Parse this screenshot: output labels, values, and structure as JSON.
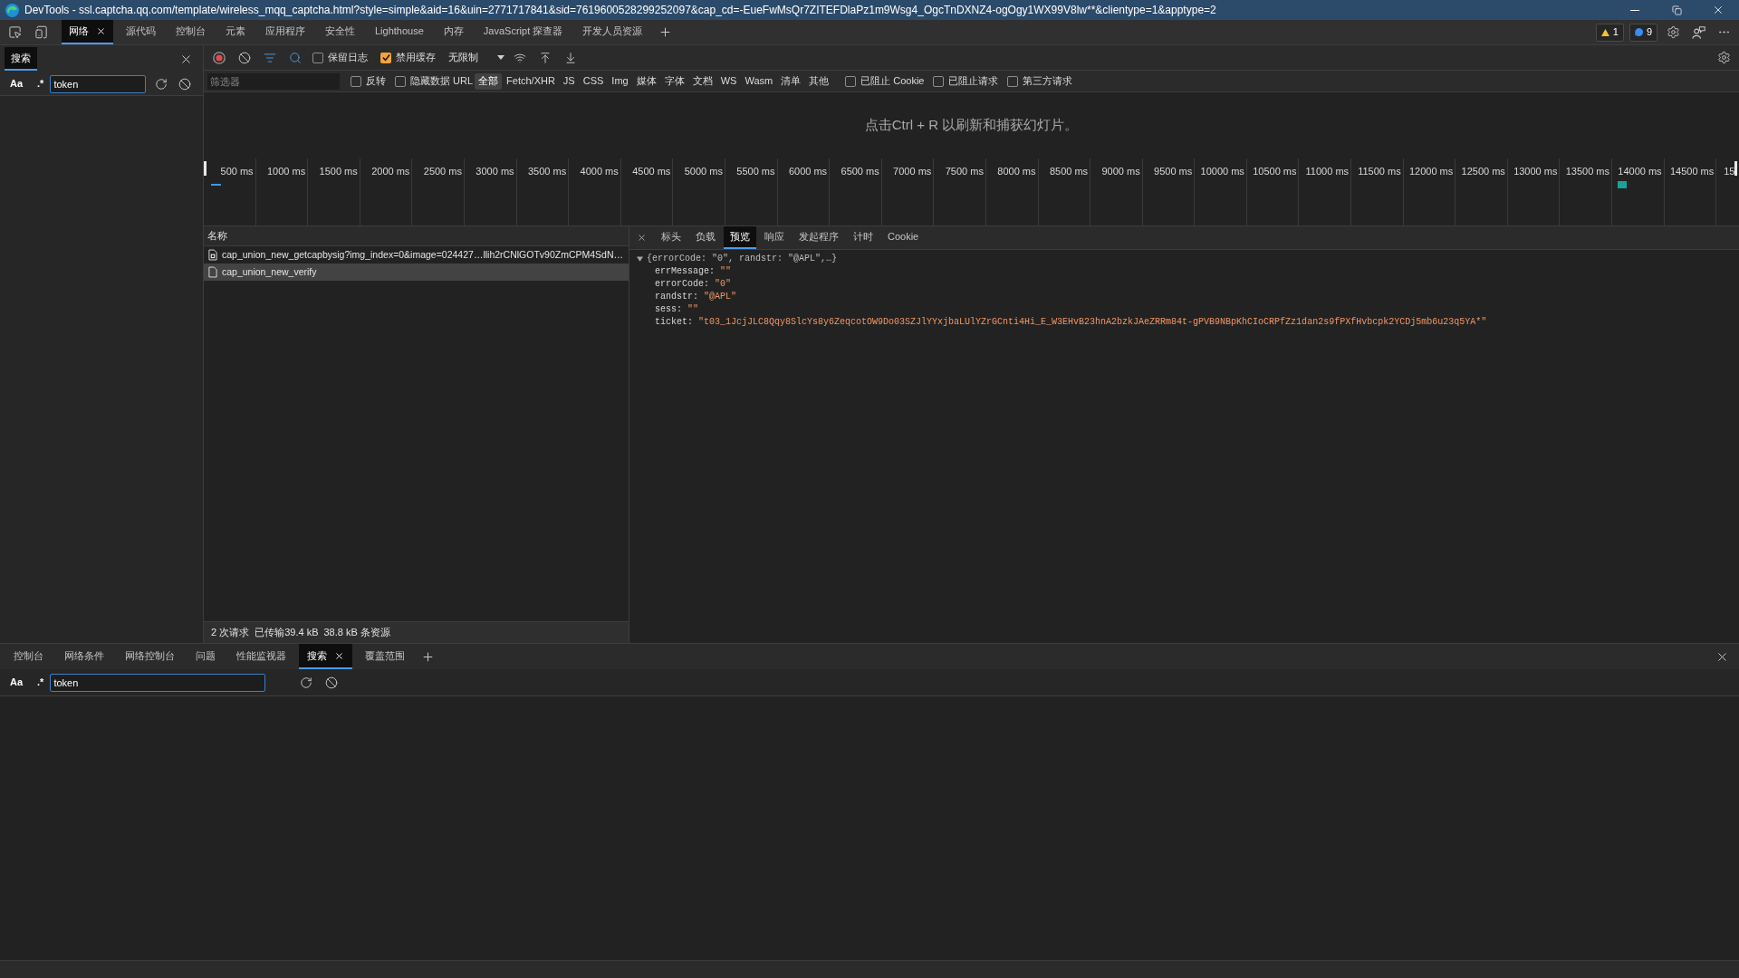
{
  "window": {
    "title": "DevTools - ssl.captcha.qq.com/template/wireless_mqq_captcha.html?style=simple&aid=16&uin=2771717841&sid=7619600528299252097&cap_cd=-EueFwMsQr7ZITEFDlaPz1m9Wsg4_OgcTnDXNZ4-ogOgy1WX99V8lw**&clientype=1&apptype=2"
  },
  "main_tabs": [
    {
      "label": "网络",
      "selected": true
    },
    {
      "label": "源代码",
      "selected": false
    },
    {
      "label": "控制台",
      "selected": false
    },
    {
      "label": "元素",
      "selected": false
    },
    {
      "label": "应用程序",
      "selected": false
    },
    {
      "label": "安全性",
      "selected": false
    },
    {
      "label": "Lighthouse",
      "selected": false
    },
    {
      "label": "内存",
      "selected": false
    },
    {
      "label": "JavaScript 探查器",
      "selected": false
    },
    {
      "label": "开发人员资源",
      "selected": false
    }
  ],
  "issue_badges": [
    {
      "kind": "warning",
      "count": "1"
    },
    {
      "kind": "info",
      "count": "9"
    }
  ],
  "search_sidebar": {
    "tab": {
      "label": "搜索",
      "selected": true
    },
    "match_case": "Aa",
    "regex": ".*",
    "query": "token"
  },
  "network_toolbar": {
    "recording": true,
    "preserve_log": {
      "label": "保留日志",
      "checked": false
    },
    "disable_cache": {
      "label": "禁用缓存",
      "checked": true
    },
    "throttling": "无限制"
  },
  "filter_bar": {
    "placeholder": "筛选器",
    "invert": {
      "label": "反转",
      "checked": false
    },
    "hide_data_urls": {
      "label": "隐藏数据 URL",
      "checked": false
    },
    "types": [
      {
        "label": "全部",
        "selected": true
      },
      {
        "label": "Fetch/XHR",
        "selected": false
      },
      {
        "label": "JS",
        "selected": false
      },
      {
        "label": "CSS",
        "selected": false
      },
      {
        "label": "Img",
        "selected": false
      },
      {
        "label": "媒体",
        "selected": false
      },
      {
        "label": "字体",
        "selected": false
      },
      {
        "label": "文档",
        "selected": false
      },
      {
        "label": "WS",
        "selected": false
      },
      {
        "label": "Wasm",
        "selected": false
      },
      {
        "label": "清单",
        "selected": false
      },
      {
        "label": "其他",
        "selected": false
      }
    ],
    "blocked_cookies": {
      "label": "已阻止 Cookie",
      "checked": false
    },
    "blocked_requests": {
      "label": "已阻止请求",
      "checked": false
    },
    "third_party": {
      "label": "第三方请求",
      "checked": false
    }
  },
  "overview": {
    "message": "点击Ctrl + R 以刷新和捕获幻灯片。",
    "ticks": [
      "500 ms",
      "1000 ms",
      "1500 ms",
      "2000 ms",
      "2500 ms",
      "3000 ms",
      "3500 ms",
      "4000 ms",
      "4500 ms",
      "5000 ms",
      "5500 ms",
      "6000 ms",
      "6500 ms",
      "7000 ms",
      "7500 ms",
      "8000 ms",
      "8500 ms",
      "9000 ms",
      "9500 ms",
      "10000 ms",
      "10500 ms",
      "11000 ms",
      "11500 ms",
      "12000 ms",
      "12500 ms",
      "13000 ms",
      "13500 ms",
      "14000 ms",
      "14500 ms",
      "15"
    ]
  },
  "request_table": {
    "column": "名称",
    "rows": [
      {
        "name": "cap_union_new_getcapbysig?img_index=0&image=024427…llih2rCNlGOTv90ZmCPM4SdN…",
        "kind": "image",
        "selected": false
      },
      {
        "name": "cap_union_new_verify",
        "kind": "document",
        "selected": true
      }
    ]
  },
  "status_bar": [
    "2 次请求",
    "已传输39.4 kB",
    "38.8 kB 条资源"
  ],
  "detail_tabs": [
    {
      "label": "标头",
      "selected": false
    },
    {
      "label": "负载",
      "selected": false
    },
    {
      "label": "预览",
      "selected": true
    },
    {
      "label": "响应",
      "selected": false
    },
    {
      "label": "发起程序",
      "selected": false
    },
    {
      "label": "计时",
      "selected": false
    },
    {
      "label": "Cookie",
      "selected": false
    }
  ],
  "preview": {
    "summary": "{errorCode: \"0\", randstr: \"@APL\",…}",
    "expanded": true,
    "fields": [
      {
        "key": "errMessage:",
        "value": "\"\""
      },
      {
        "key": "errorCode:",
        "value": "\"0\""
      },
      {
        "key": "randstr:",
        "value": "\"@APL\""
      },
      {
        "key": "sess:",
        "value": "\"\""
      },
      {
        "key": "ticket:",
        "value": "\"t03_1JcjJLC8Qqy8SlcYs8y6ZeqcotOW9Do03SZJlYYxjbaLUlYZrGCnti4Hi_E_W3EHvB23hnA2bzkJAeZRRm84t-gPVB9NBpKhCIoCRPfZz1dan2s9fPXfHvbcpk2YCDj5mb6u23q5YA*\""
      }
    ]
  },
  "drawer_tabs": [
    {
      "label": "控制台",
      "selected": false
    },
    {
      "label": "网络条件",
      "selected": false
    },
    {
      "label": "网络控制台",
      "selected": false
    },
    {
      "label": "问题",
      "selected": false
    },
    {
      "label": "性能监视器",
      "selected": false
    },
    {
      "label": "搜索",
      "selected": true
    },
    {
      "label": "覆盖范围",
      "selected": false
    }
  ],
  "drawer_search": {
    "match_case": "Aa",
    "regex": ".*",
    "query": "token"
  }
}
